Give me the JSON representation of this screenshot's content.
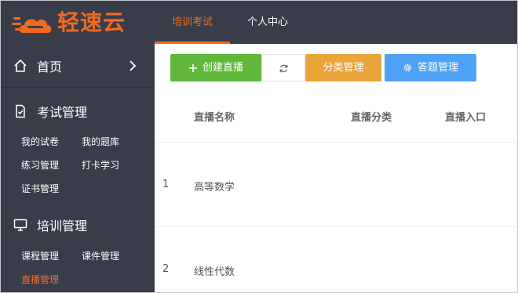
{
  "brand": {
    "name": "轻速云",
    "accent": "#f26b21"
  },
  "topnav": {
    "tabs": [
      {
        "label": "培训考试",
        "active": true
      },
      {
        "label": "个人中心",
        "active": false
      }
    ]
  },
  "sidebar": {
    "home": "首页",
    "sections": [
      {
        "title": "考试管理",
        "icon": "exam-icon",
        "links": [
          "我的试卷",
          "我的题库",
          "练习管理",
          "打卡学习",
          "证书管理"
        ]
      },
      {
        "title": "培训管理",
        "icon": "monitor-icon",
        "links": [
          "课程管理",
          "课件管理",
          "直播管理"
        ],
        "active_link": "直播管理"
      }
    ]
  },
  "toolbar": {
    "create": "创建直播",
    "category": "分类管理",
    "qa": "答题管理"
  },
  "table": {
    "headers": [
      "直播名称",
      "直播分类",
      "直播入口"
    ],
    "rows": [
      {
        "index": "1",
        "name": "高等数学"
      },
      {
        "index": "2",
        "name": "线性代数"
      }
    ]
  },
  "colors": {
    "sidebar": "#393d49",
    "green": "#5fb83b",
    "orange": "#eaa53a",
    "blue": "#4ea3f7"
  }
}
